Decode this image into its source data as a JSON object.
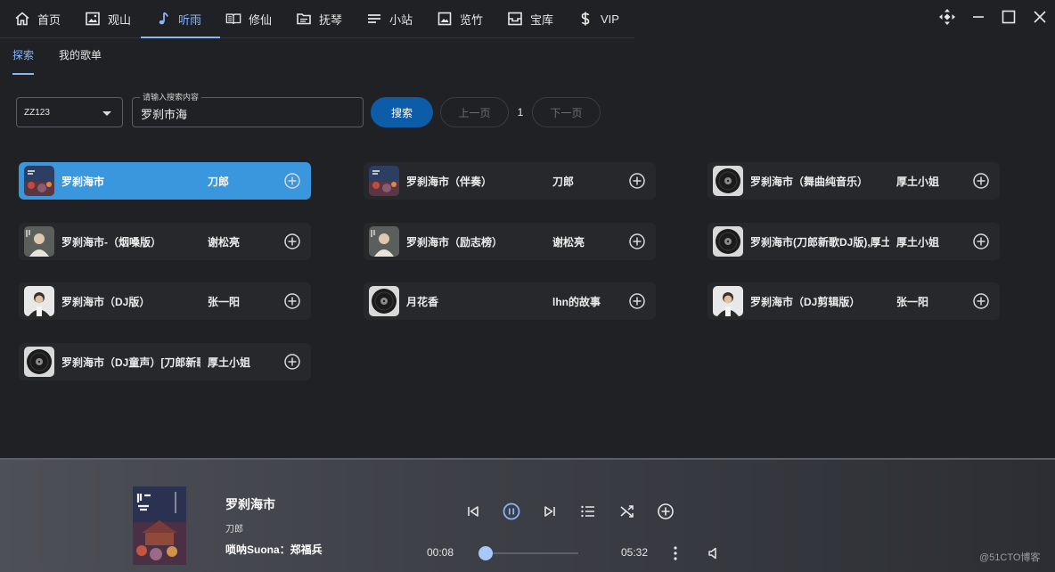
{
  "nav": {
    "items": [
      {
        "label": "首页",
        "icon": "home-icon"
      },
      {
        "label": "观山",
        "icon": "image-icon"
      },
      {
        "label": "听雨",
        "icon": "music-note-icon"
      },
      {
        "label": "修仙",
        "icon": "book-icon"
      },
      {
        "label": "抚琴",
        "icon": "folder-icon"
      },
      {
        "label": "小站",
        "icon": "lines-icon"
      },
      {
        "label": "览竹",
        "icon": "picture-icon"
      },
      {
        "label": "宝库",
        "icon": "archive-icon"
      },
      {
        "label": "VIP",
        "icon": "dollar-icon"
      }
    ],
    "active_index": 2
  },
  "window_controls": [
    "move-icon",
    "minimize-icon",
    "maximize-icon",
    "close-icon"
  ],
  "subtabs": {
    "search": "探索",
    "playlist": "我的歌单"
  },
  "search": {
    "source": "ZZ123",
    "label": "请输入搜索内容",
    "value": "罗刹市海",
    "button": "搜索",
    "prev": "上一页",
    "page": "1",
    "next": "下一页"
  },
  "results": [
    {
      "title": "罗刹海市",
      "artist": "刀郎",
      "active": true,
      "thumb": "album-art"
    },
    {
      "title": "罗刹海市（伴奏）",
      "artist": "刀郎",
      "thumb": "album-art"
    },
    {
      "title": "罗刹海市（舞曲纯音乐）",
      "artist": "厚土小姐",
      "thumb": "vinyl"
    },
    {
      "title": "罗刹海市-（烟嗓版）",
      "artist": "谢松亮",
      "thumb": "portrait-light"
    },
    {
      "title": "罗刹海市（励志榜）",
      "artist": "谢松亮",
      "thumb": "portrait-light"
    },
    {
      "title": "罗刹海市(刀郎新歌DJ版),厚土",
      "artist": "厚土小姐",
      "thumb": "vinyl"
    },
    {
      "title": "罗刹海市（DJ版）",
      "artist": "张一阳",
      "thumb": "portrait"
    },
    {
      "title": "月花香",
      "artist": "lhn的故事",
      "thumb": "vinyl"
    },
    {
      "title": "罗刹海市（DJ剪辑版）",
      "artist": "张一阳",
      "thumb": "portrait"
    },
    {
      "title": "罗刹海市（DJ童声）[刀郎新歌",
      "artist": "厚土小姐",
      "thumb": "vinyl"
    }
  ],
  "player": {
    "title": "罗刹海市",
    "artist": "刀郎",
    "extra": "唢呐Suona：郑福兵",
    "current_time": "00:08",
    "total_time": "05:32",
    "progress": 0.025
  },
  "watermark": "@51CTO博客",
  "colors": {
    "accent": "#8ab4f8",
    "active_card": "#3a96dd",
    "search_button": "#0c5ca8"
  }
}
